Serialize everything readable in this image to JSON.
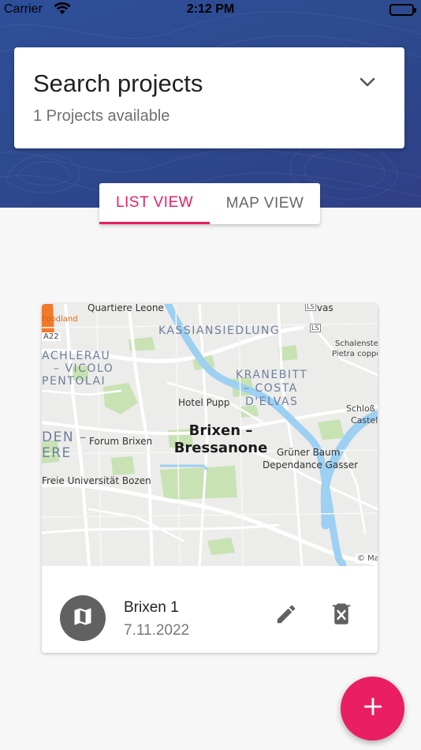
{
  "status_bar": {
    "carrier": "Carrier",
    "time": "2:12 PM"
  },
  "search": {
    "title": "Search projects",
    "subtitle": "1 Projects available"
  },
  "tabs": [
    {
      "label": "LIST VIEW",
      "active": true
    },
    {
      "label": "MAP VIEW",
      "active": false
    }
  ],
  "project": {
    "name": "Brixen 1",
    "date": "7.11.2022",
    "map_labels": {
      "quartiere_leone": "Quartiere Leone",
      "elvas": "Elvas",
      "kassiansiedlung": "KASSIANSIEDLUNG",
      "foodland": "Foodland",
      "schalenstein": "Schalenste",
      "pietra": "Pietra coppel",
      "a22": "A22",
      "stufels_1": "ACHLERAU",
      "stufels_2": "– VICOLO",
      "stufels_3": "PENTOLAI",
      "kranebitt_1": "KRANEBITT",
      "kranebitt_2": "– COSTA",
      "kranebitt_3": "D'ELVAS",
      "hotel_pupp": "Hotel Pupp",
      "schloss_1": "Schloß",
      "schloss_2": "Castel",
      "rosslauf_1": "DEN –",
      "rosslauf_2": "ERE",
      "forum": "Forum Brixen",
      "city_1": "Brixen –",
      "city_2": "Bressanone",
      "gruener_1": "Grüner Baum",
      "gruener_2": "Dependance Gasser",
      "uni": "Freie Universität Bozen",
      "ls1": "LS",
      "ls2": "LS",
      "attribution": "© Ma"
    }
  },
  "colors": {
    "accent": "#e91e63",
    "hero": "#2e4a8f",
    "icon": "#616161"
  },
  "icons": {
    "wifi": "wifi-icon",
    "battery": "battery-icon",
    "chevron": "chevron-down-icon",
    "map": "map-icon",
    "edit": "pencil-icon",
    "delete": "delete-icon",
    "add": "plus-icon"
  }
}
